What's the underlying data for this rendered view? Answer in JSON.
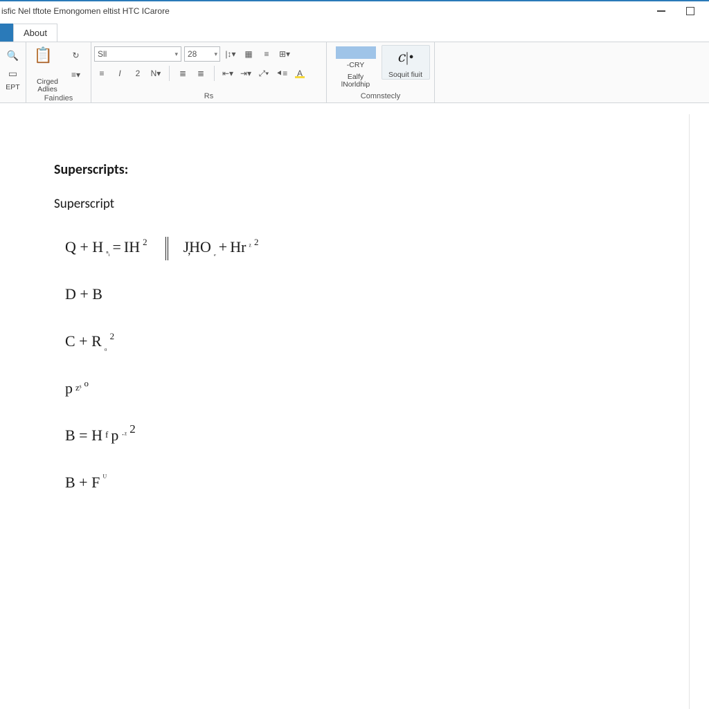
{
  "window": {
    "title": "isfic Nel tftote Emongomen eltist HTC ICarore"
  },
  "tabs": {
    "about": "About"
  },
  "ribbon": {
    "group1": {
      "ept": "EPT",
      "clipbd1": "Cirged",
      "clipbd2": "Adlies",
      "label": "Faindies"
    },
    "font": {
      "family": "Sll",
      "size": "28",
      "label": "Rs"
    },
    "styles": {
      "btn1a": "📄",
      "btn1b": "-CRY",
      "btn2": "Ealfy lNorldhip",
      "btn3": "Soquit fiuit",
      "label": "Comnstecly"
    }
  },
  "document": {
    "heading": "Superscripts:",
    "subheading": "Superscript",
    "eq1": {
      "p1": "Q + H",
      "p1sub": "ⁿᵢ",
      "eq": " = ",
      "p2": "IH",
      "p2sup": "2",
      "p3": "J̦HO",
      "p3sub": "ₑ",
      "plus2": "  +  ",
      "p4": "Hr",
      "p4supa": "ᶻ",
      "p4supb": "2"
    },
    "eq2": {
      "text": "D + B"
    },
    "eq3": {
      "p1": "C + R",
      "sub": "₀",
      "sup": "2"
    },
    "eq4": {
      "p1": "p",
      "supa": "zˢ",
      "supb": "o"
    },
    "eq5": {
      "p1": "B  =  H",
      "top1": "f",
      "p2": "p",
      "supa": "·ᶻ",
      "supb": "2"
    },
    "eq6": {
      "p1": "B + F",
      "sup": "ᵁ"
    }
  }
}
